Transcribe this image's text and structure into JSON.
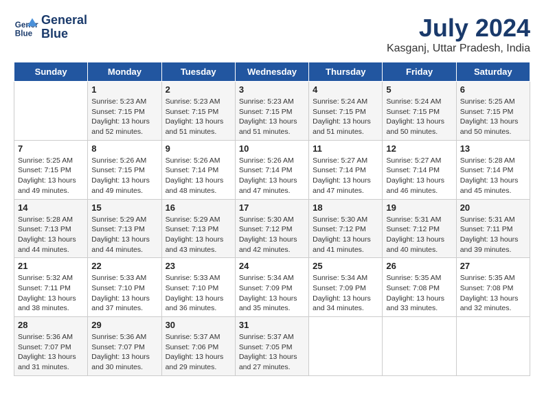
{
  "header": {
    "logo_line1": "General",
    "logo_line2": "Blue",
    "month_year": "July 2024",
    "location": "Kasganj, Uttar Pradesh, India"
  },
  "days": [
    "Sunday",
    "Monday",
    "Tuesday",
    "Wednesday",
    "Thursday",
    "Friday",
    "Saturday"
  ],
  "weeks": [
    [
      {
        "date": "",
        "info": ""
      },
      {
        "date": "1",
        "info": "Sunrise: 5:23 AM\nSunset: 7:15 PM\nDaylight: 13 hours\nand 52 minutes."
      },
      {
        "date": "2",
        "info": "Sunrise: 5:23 AM\nSunset: 7:15 PM\nDaylight: 13 hours\nand 51 minutes."
      },
      {
        "date": "3",
        "info": "Sunrise: 5:23 AM\nSunset: 7:15 PM\nDaylight: 13 hours\nand 51 minutes."
      },
      {
        "date": "4",
        "info": "Sunrise: 5:24 AM\nSunset: 7:15 PM\nDaylight: 13 hours\nand 51 minutes."
      },
      {
        "date": "5",
        "info": "Sunrise: 5:24 AM\nSunset: 7:15 PM\nDaylight: 13 hours\nand 50 minutes."
      },
      {
        "date": "6",
        "info": "Sunrise: 5:25 AM\nSunset: 7:15 PM\nDaylight: 13 hours\nand 50 minutes."
      }
    ],
    [
      {
        "date": "7",
        "info": "Sunrise: 5:25 AM\nSunset: 7:15 PM\nDaylight: 13 hours\nand 49 minutes."
      },
      {
        "date": "8",
        "info": "Sunrise: 5:26 AM\nSunset: 7:15 PM\nDaylight: 13 hours\nand 49 minutes."
      },
      {
        "date": "9",
        "info": "Sunrise: 5:26 AM\nSunset: 7:14 PM\nDaylight: 13 hours\nand 48 minutes."
      },
      {
        "date": "10",
        "info": "Sunrise: 5:26 AM\nSunset: 7:14 PM\nDaylight: 13 hours\nand 47 minutes."
      },
      {
        "date": "11",
        "info": "Sunrise: 5:27 AM\nSunset: 7:14 PM\nDaylight: 13 hours\nand 47 minutes."
      },
      {
        "date": "12",
        "info": "Sunrise: 5:27 AM\nSunset: 7:14 PM\nDaylight: 13 hours\nand 46 minutes."
      },
      {
        "date": "13",
        "info": "Sunrise: 5:28 AM\nSunset: 7:14 PM\nDaylight: 13 hours\nand 45 minutes."
      }
    ],
    [
      {
        "date": "14",
        "info": "Sunrise: 5:28 AM\nSunset: 7:13 PM\nDaylight: 13 hours\nand 44 minutes."
      },
      {
        "date": "15",
        "info": "Sunrise: 5:29 AM\nSunset: 7:13 PM\nDaylight: 13 hours\nand 44 minutes."
      },
      {
        "date": "16",
        "info": "Sunrise: 5:29 AM\nSunset: 7:13 PM\nDaylight: 13 hours\nand 43 minutes."
      },
      {
        "date": "17",
        "info": "Sunrise: 5:30 AM\nSunset: 7:12 PM\nDaylight: 13 hours\nand 42 minutes."
      },
      {
        "date": "18",
        "info": "Sunrise: 5:30 AM\nSunset: 7:12 PM\nDaylight: 13 hours\nand 41 minutes."
      },
      {
        "date": "19",
        "info": "Sunrise: 5:31 AM\nSunset: 7:12 PM\nDaylight: 13 hours\nand 40 minutes."
      },
      {
        "date": "20",
        "info": "Sunrise: 5:31 AM\nSunset: 7:11 PM\nDaylight: 13 hours\nand 39 minutes."
      }
    ],
    [
      {
        "date": "21",
        "info": "Sunrise: 5:32 AM\nSunset: 7:11 PM\nDaylight: 13 hours\nand 38 minutes."
      },
      {
        "date": "22",
        "info": "Sunrise: 5:33 AM\nSunset: 7:10 PM\nDaylight: 13 hours\nand 37 minutes."
      },
      {
        "date": "23",
        "info": "Sunrise: 5:33 AM\nSunset: 7:10 PM\nDaylight: 13 hours\nand 36 minutes."
      },
      {
        "date": "24",
        "info": "Sunrise: 5:34 AM\nSunset: 7:09 PM\nDaylight: 13 hours\nand 35 minutes."
      },
      {
        "date": "25",
        "info": "Sunrise: 5:34 AM\nSunset: 7:09 PM\nDaylight: 13 hours\nand 34 minutes."
      },
      {
        "date": "26",
        "info": "Sunrise: 5:35 AM\nSunset: 7:08 PM\nDaylight: 13 hours\nand 33 minutes."
      },
      {
        "date": "27",
        "info": "Sunrise: 5:35 AM\nSunset: 7:08 PM\nDaylight: 13 hours\nand 32 minutes."
      }
    ],
    [
      {
        "date": "28",
        "info": "Sunrise: 5:36 AM\nSunset: 7:07 PM\nDaylight: 13 hours\nand 31 minutes."
      },
      {
        "date": "29",
        "info": "Sunrise: 5:36 AM\nSunset: 7:07 PM\nDaylight: 13 hours\nand 30 minutes."
      },
      {
        "date": "30",
        "info": "Sunrise: 5:37 AM\nSunset: 7:06 PM\nDaylight: 13 hours\nand 29 minutes."
      },
      {
        "date": "31",
        "info": "Sunrise: 5:37 AM\nSunset: 7:05 PM\nDaylight: 13 hours\nand 27 minutes."
      },
      {
        "date": "",
        "info": ""
      },
      {
        "date": "",
        "info": ""
      },
      {
        "date": "",
        "info": ""
      }
    ]
  ]
}
